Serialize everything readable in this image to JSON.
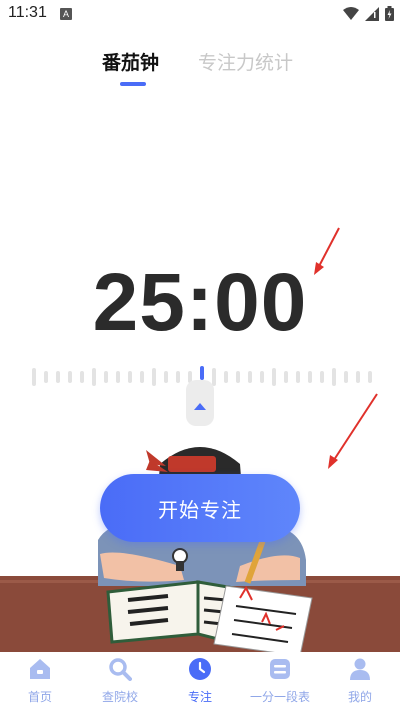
{
  "status_bar": {
    "time": "11:31",
    "notification_icon": "A"
  },
  "tabs": [
    {
      "label": "番茄钟",
      "active": true
    },
    {
      "label": "专注力统计",
      "active": false
    }
  ],
  "timer": {
    "display": "25:00"
  },
  "start_button": {
    "label": "开始专注"
  },
  "bottom_nav": [
    {
      "label": "首页",
      "icon": "home-icon",
      "active": false
    },
    {
      "label": "查院校",
      "icon": "search-icon",
      "active": false
    },
    {
      "label": "专注",
      "icon": "clock-icon",
      "active": true
    },
    {
      "label": "一分一段表",
      "icon": "table-icon",
      "active": false
    },
    {
      "label": "我的",
      "icon": "person-icon",
      "active": false
    }
  ],
  "colors": {
    "accent": "#4a6cf7",
    "nav_inactive": "#8fa6e8",
    "annotation": "#e0312b"
  }
}
